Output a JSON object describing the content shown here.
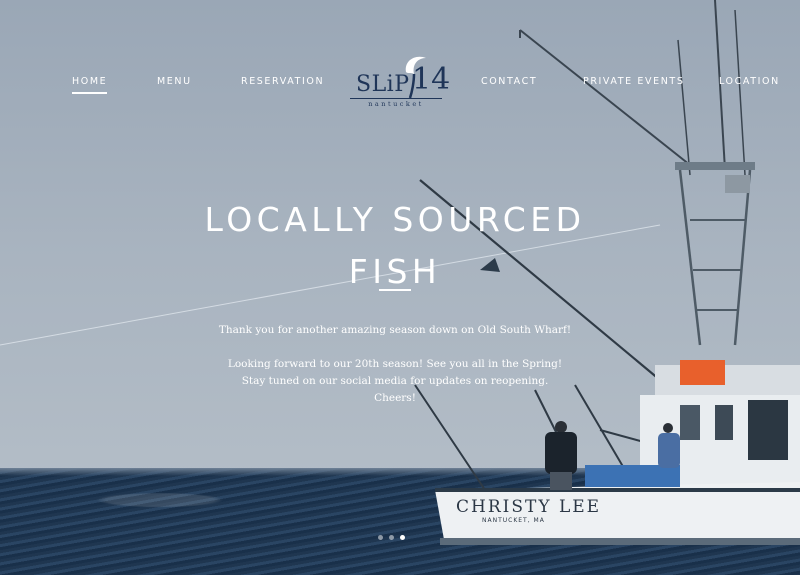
{
  "nav": {
    "items": [
      {
        "label": "HOME",
        "active": true
      },
      {
        "label": "MENU",
        "active": false
      },
      {
        "label": "RESERVATION",
        "active": false
      },
      {
        "label": "CONTACT",
        "active": false
      },
      {
        "label": "PRIVATE EVENTS",
        "active": false
      },
      {
        "label": "LOCATION",
        "active": false
      }
    ],
    "logo": {
      "name": "SLiP",
      "number": "14",
      "subtitle": "nantucket"
    }
  },
  "hero": {
    "headline_line1": "LOCALLY SOURCED",
    "headline_line2": "FISH",
    "message": [
      "Thank you for another amazing season down on Old South Wharf!",
      "Looking forward to our 20th season! See you all in the Spring!",
      "Stay tuned on our social media for updates on reopening.",
      "Cheers!"
    ],
    "boat_name": "CHRISTY LEE",
    "boat_port": "NANTUCKET, MA"
  },
  "slider": {
    "count": 3,
    "active_index": 2
  },
  "colors": {
    "accent": "#ffffff",
    "logo": "#1f3558",
    "sky": "#a9b4c0",
    "sea": "#233d5a"
  }
}
